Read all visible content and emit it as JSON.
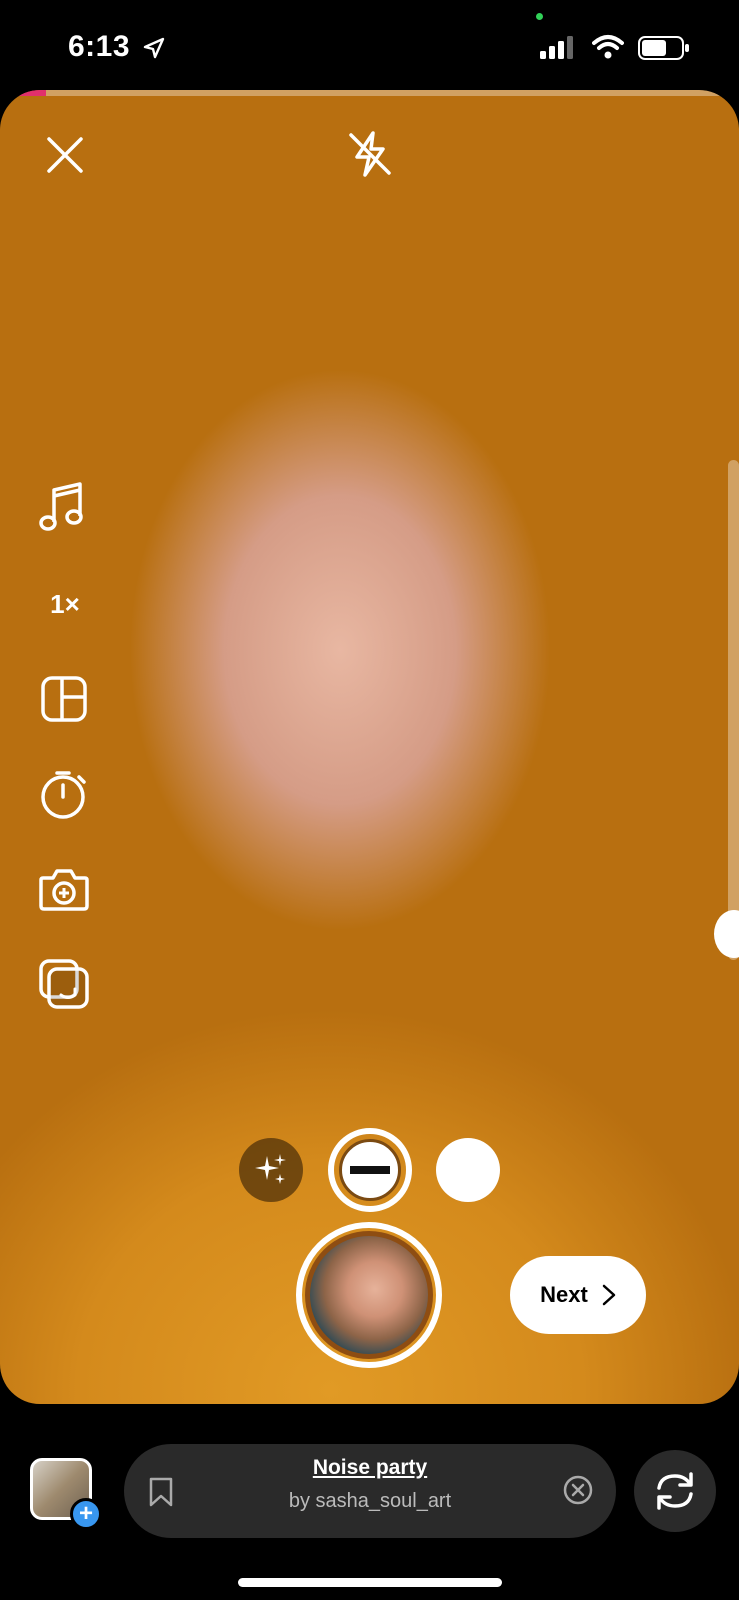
{
  "status": {
    "time": "6:13"
  },
  "camera": {
    "speed_label": "1×",
    "next_label": "Next"
  },
  "effect": {
    "name": "Noise party",
    "author": "by sasha_soul_art"
  },
  "colors": {
    "progress": "#e1306c",
    "gallery_badge": "#3897f0",
    "recording_ring": "#8e4d12"
  },
  "icons": {
    "close": "close-icon",
    "flash": "flash-off-icon",
    "music": "music-note-icon",
    "layout": "layout-grid-icon",
    "timer": "timer-icon",
    "dualcam": "dual-camera-icon",
    "multi": "multi-capture-icon",
    "sparkle": "sparkle-icon",
    "save": "bookmark-icon",
    "remove": "remove-circle-icon",
    "flip": "flip-camera-icon"
  }
}
